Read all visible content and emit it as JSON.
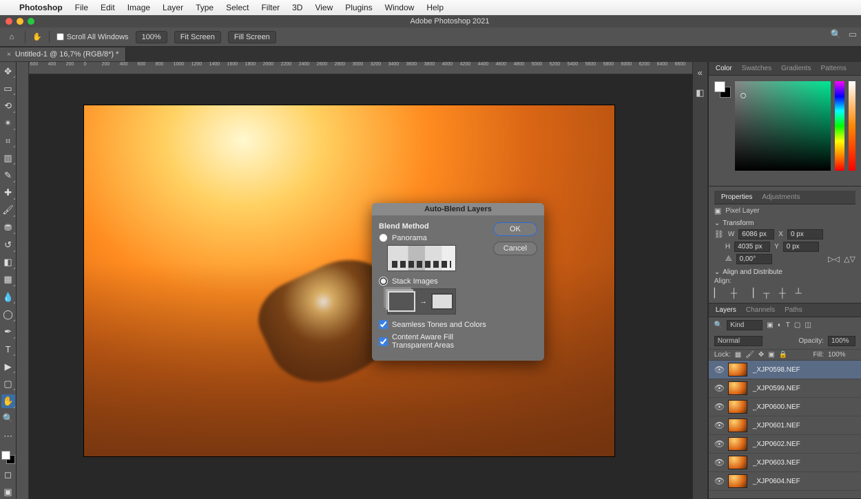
{
  "menubar": {
    "app": "Photoshop",
    "items": [
      "File",
      "Edit",
      "Image",
      "Layer",
      "Type",
      "Select",
      "Filter",
      "3D",
      "View",
      "Plugins",
      "Window",
      "Help"
    ]
  },
  "window_title": "Adobe Photoshop 2021",
  "options": {
    "scroll_all": "Scroll All Windows",
    "zoom": "100%",
    "fit": "Fit Screen",
    "fill": "Fill Screen"
  },
  "doc_tab": "Untitled-1 @ 16,7% (RGB/8*) *",
  "ruler_h": [
    "600",
    "400",
    "200",
    "0",
    "200",
    "400",
    "600",
    "800",
    "1000",
    "1200",
    "1400",
    "1600",
    "1800",
    "2000",
    "2200",
    "2400",
    "2600",
    "2800",
    "3000",
    "3200",
    "3400",
    "3600",
    "3800",
    "4000",
    "4200",
    "4400",
    "4600",
    "4800",
    "5000",
    "5200",
    "5400",
    "5600",
    "5800",
    "6000",
    "6200",
    "6400",
    "6600"
  ],
  "panels": {
    "color_tabs": [
      "Color",
      "Swatches",
      "Gradients",
      "Patterns"
    ],
    "props_tabs": [
      "Properties",
      "Adjustments"
    ],
    "pixel_layer": "Pixel Layer",
    "transform": "Transform",
    "W": "6086 px",
    "H": "4035 px",
    "X": "0 px",
    "Y": "0 px",
    "angle": "0,00°",
    "align_hdr": "Align and Distribute",
    "align_lbl": "Align:",
    "layers_tabs": [
      "Layers",
      "Channels",
      "Paths"
    ],
    "kind": "Kind",
    "blend": "Normal",
    "opacity_lbl": "Opacity:",
    "opacity_val": "100%",
    "lock": "Lock:",
    "fill_lbl": "Fill:",
    "fill_val": "100%",
    "layers": [
      "_XJP0598.NEF",
      "_XJP0599.NEF",
      "_XJP0600.NEF",
      "_XJP0601.NEF",
      "_XJP0602.NEF",
      "_XJP0603.NEF",
      "_XJP0604.NEF"
    ]
  },
  "dialog": {
    "title": "Auto-Blend Layers",
    "method": "Blend Method",
    "panorama": "Panorama",
    "stack": "Stack Images",
    "seamless": "Seamless Tones and Colors",
    "contentaware": "Content Aware Fill Transparent Areas",
    "ok": "OK",
    "cancel": "Cancel"
  }
}
